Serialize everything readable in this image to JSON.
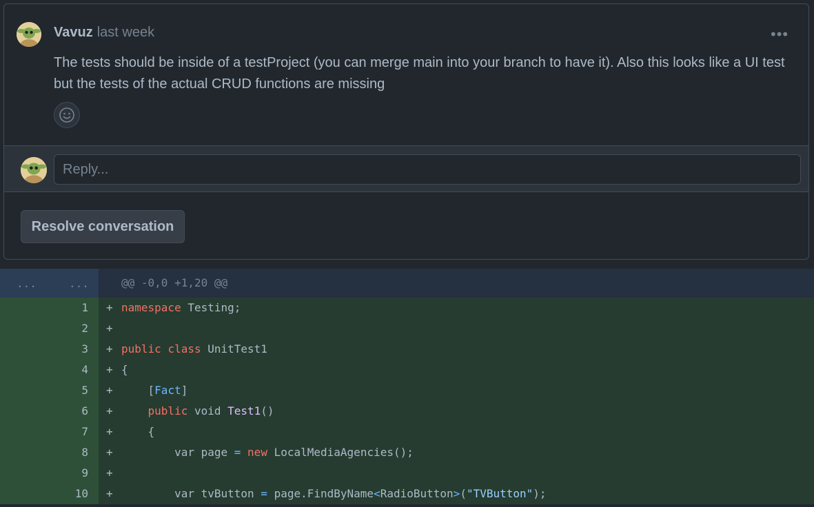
{
  "comment": {
    "author": "Vavuz",
    "time": "last week",
    "more_icon": "kebab-horizontal-icon",
    "more_glyph": "•••",
    "body": "The tests should be inside of a testProject (you can merge main into your branch to have it). Also this looks like a UI test but the tests of the actual CRUD functions are missing",
    "reaction_icon": "smiley-icon"
  },
  "reply": {
    "placeholder": "Reply..."
  },
  "resolve_label": "Resolve conversation",
  "diff": {
    "expand_left": "...",
    "expand_right": "...",
    "hunk_header": "@@ -0,0 +1,20 @@",
    "lines": [
      {
        "num": "1",
        "sign": "+",
        "code": "namespace Testing;"
      },
      {
        "num": "2",
        "sign": "+",
        "code": ""
      },
      {
        "num": "3",
        "sign": "+",
        "code": "public class UnitTest1"
      },
      {
        "num": "4",
        "sign": "+",
        "code": "{"
      },
      {
        "num": "5",
        "sign": "+",
        "code": "    [Fact]"
      },
      {
        "num": "6",
        "sign": "+",
        "code": "    public void Test1()"
      },
      {
        "num": "7",
        "sign": "+",
        "code": "    {"
      },
      {
        "num": "8",
        "sign": "+",
        "code": "        var page = new LocalMediaAgencies();"
      },
      {
        "num": "9",
        "sign": "+",
        "code": ""
      },
      {
        "num": "10",
        "sign": "+",
        "code": "        var tvButton = page.FindByName<RadioButton>(\"TVButton\");"
      }
    ]
  },
  "colors": {
    "background": "#22272e",
    "added_line_bg": "#263c30",
    "added_gutter_bg": "#2e5038",
    "keyword": "#f47067",
    "type": "#6cb6ff"
  }
}
